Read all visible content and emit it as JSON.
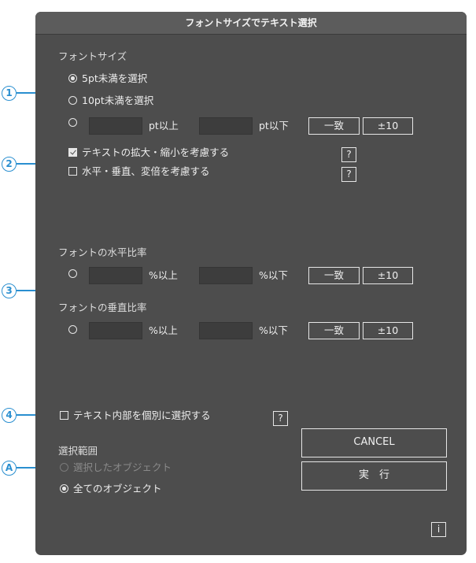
{
  "dialog": {
    "title": "フォントサイズでテキスト選択"
  },
  "markers": [
    "1",
    "2",
    "3",
    "4",
    "A"
  ],
  "font_size": {
    "section_label": "フォントサイズ",
    "option_below5": "5pt未満を選択",
    "option_below10": "10pt未満を選択",
    "range_min_suffix": "pt以上",
    "range_max_suffix": "pt以下",
    "range_min_value": "",
    "range_max_value": "",
    "match_button": "一致",
    "pm10_button": "±10"
  },
  "options": {
    "consider_scale": "テキストの拡大・縮小を考慮する",
    "consider_hv": "水平・垂直、変倍を考慮する",
    "help": "?"
  },
  "horizontal_ratio": {
    "section_label": "フォントの水平比率",
    "min_suffix": "%以上",
    "max_suffix": "%以下",
    "min_value": "",
    "max_value": "",
    "match_button": "一致",
    "pm10_button": "±10"
  },
  "vertical_ratio": {
    "section_label": "フォントの垂直比率",
    "min_suffix": "%以上",
    "max_suffix": "%以下",
    "min_value": "",
    "max_value": "",
    "match_button": "一致",
    "pm10_button": "±10"
  },
  "inner_text": {
    "label": "テキスト内部を個別に選択する",
    "help": "?"
  },
  "scope": {
    "section_label": "選択範囲",
    "selected_objects": "選択したオブジェクト",
    "all_objects": "全てのオブジェクト"
  },
  "buttons": {
    "cancel": "CANCEL",
    "execute": "実　行",
    "info": "i"
  },
  "colors": {
    "annotation": "#2a8fd0",
    "panel": "#4d4d4d"
  }
}
